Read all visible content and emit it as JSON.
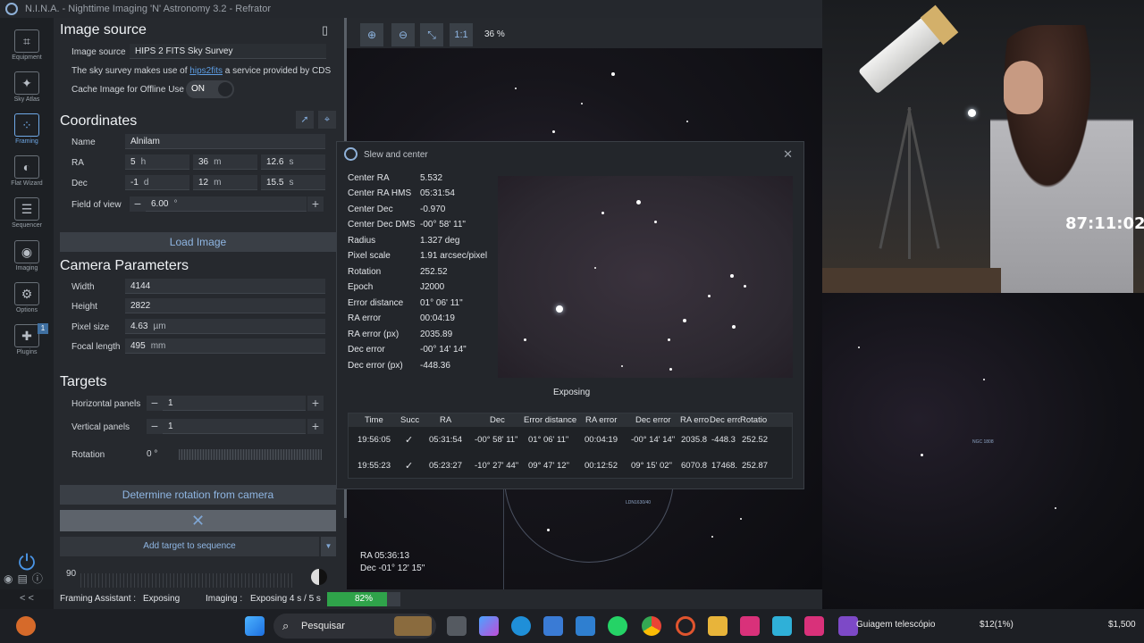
{
  "app": {
    "title": "N.I.N.A. - Nighttime Imaging 'N' Astronomy 3.2  -  Refrator"
  },
  "sidebar": {
    "items": [
      {
        "label": "Equipment",
        "icon": "equipment-icon"
      },
      {
        "label": "Sky Atlas",
        "icon": "sky-atlas-icon"
      },
      {
        "label": "Framing",
        "icon": "framing-icon"
      },
      {
        "label": "Flat Wizard",
        "icon": "flat-wizard-icon"
      },
      {
        "label": "Sequencer",
        "icon": "sequencer-icon"
      },
      {
        "label": "Imaging",
        "icon": "imaging-icon"
      },
      {
        "label": "Options",
        "icon": "options-icon"
      },
      {
        "label": "Plugins",
        "icon": "plugins-icon",
        "badge": "1"
      }
    ],
    "collapse": "< <"
  },
  "image_source": {
    "heading": "Image source",
    "label": "Image source",
    "selected": "HIPS 2 FITS Sky Survey",
    "info_pre": "The sky survey makes use of ",
    "info_link": "hips2fits",
    "info_post": " a service provided by CDS",
    "cache_label": "Cache Image for Offline Use",
    "cache_state": "ON"
  },
  "coordinates": {
    "heading": "Coordinates",
    "name_label": "Name",
    "name_value": "Alnilam",
    "ra_label": "RA",
    "ra_h": "5",
    "ra_h_u": "h",
    "ra_m": "36",
    "ra_m_u": "m",
    "ra_s": "12.6",
    "ra_s_u": "s",
    "dec_label": "Dec",
    "dec_d": "-1",
    "dec_d_u": "d",
    "dec_m": "12",
    "dec_m_u": "m",
    "dec_s": "15.5",
    "dec_s_u": "s",
    "fov_label": "Field of view",
    "fov_value": "6.00",
    "fov_unit": "°",
    "load_button": "Load Image"
  },
  "camera": {
    "heading": "Camera Parameters",
    "width_label": "Width",
    "width_value": "4144",
    "height_label": "Height",
    "height_value": "2822",
    "pixel_label": "Pixel size",
    "pixel_value": "4.63",
    "pixel_unit": "µm",
    "focal_label": "Focal length",
    "focal_value": "495",
    "focal_unit": "mm"
  },
  "targets": {
    "heading": "Targets",
    "hpanels_label": "Horizontal panels",
    "hpanels_value": "1",
    "vpanels_label": "Vertical panels",
    "vpanels_value": "1",
    "rotation_label": "Rotation",
    "rotation_value": "0",
    "rotation_unit": "°",
    "determine_button": "Determine rotation from camera",
    "add_sequence_button": "Add target to sequence",
    "bottom_value": "90"
  },
  "viewer": {
    "zoom_fit": "1:1",
    "zoom_level": "36 %",
    "ra_readout": "RA  05:36:13",
    "dec_readout": "Dec  -01° 12' 15\"",
    "labels": [
      "LDN1630/40",
      "NGC 1808"
    ]
  },
  "dialog": {
    "title": "Slew and center",
    "fields": [
      {
        "k": "Center RA",
        "v": "5.532"
      },
      {
        "k": "Center RA HMS",
        "v": "05:31:54"
      },
      {
        "k": "Center Dec",
        "v": "-0.970"
      },
      {
        "k": "Center Dec DMS",
        "v": "-00° 58' 11\""
      },
      {
        "k": "Radius",
        "v": "1.327 deg"
      },
      {
        "k": "Pixel scale",
        "v": "1.91 arcsec/pixel"
      },
      {
        "k": "Rotation",
        "v": "252.52"
      },
      {
        "k": "Epoch",
        "v": "J2000"
      },
      {
        "k": "Error distance",
        "v": "01° 06' 11\""
      },
      {
        "k": "RA error",
        "v": "00:04:19"
      },
      {
        "k": "RA error (px)",
        "v": "2035.89"
      },
      {
        "k": "Dec error",
        "v": "-00° 14' 14\""
      },
      {
        "k": "Dec error (px)",
        "v": "-448.36"
      }
    ],
    "status": "Exposing",
    "columns": [
      "Time",
      "Succ",
      "RA",
      "Dec",
      "Error distance",
      "RA error",
      "Dec error",
      "RA erro",
      "Dec erro",
      "Rotatio"
    ],
    "rows": [
      [
        "19:56:05",
        "✓",
        "05:31:54",
        "-00° 58' 11\"",
        "01° 06' 11\"",
        "00:04:19",
        "-00° 14' 14\"",
        "2035.8",
        "-448.3",
        "252.52"
      ],
      [
        "19:55:23",
        "✓",
        "05:23:27",
        "-10° 27' 44\"",
        "09° 47' 12\"",
        "00:12:52",
        "09° 15' 02\"",
        "6070.8",
        "17468.",
        "252.87"
      ]
    ]
  },
  "status": {
    "framing_label": "Framing Assistant :",
    "framing_value": "Exposing",
    "imaging_label": "Imaging :",
    "imaging_value": "Exposing 4 s / 5 s",
    "progress_text": "82%",
    "progress": 0.82
  },
  "webcam": {
    "timer": "87:11:02"
  },
  "taskbar": {
    "search_placeholder": "Pesquisar",
    "window_label": "Guiagem telescópio",
    "ticker1": "$12(1%)",
    "ticker2": "$1,500"
  }
}
